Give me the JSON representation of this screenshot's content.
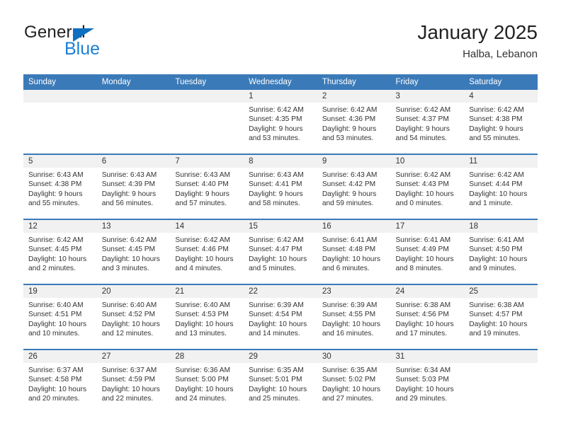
{
  "brand": {
    "name_part1": "General",
    "name_part2": "Blue",
    "triangle_color": "#0f6fc0",
    "blue_text_color": "#1b7fd4"
  },
  "header": {
    "title": "January 2025",
    "subtitle": "Halba, Lebanon",
    "accent_color": "#3b7ab8",
    "band_color": "#f1f1f1"
  },
  "weekday_headers": [
    "Sunday",
    "Monday",
    "Tuesday",
    "Wednesday",
    "Thursday",
    "Friday",
    "Saturday"
  ],
  "weeks": [
    [
      {
        "day": "",
        "lines": []
      },
      {
        "day": "",
        "lines": []
      },
      {
        "day": "",
        "lines": []
      },
      {
        "day": "1",
        "lines": [
          "Sunrise: 6:42 AM",
          "Sunset: 4:35 PM",
          "Daylight: 9 hours",
          "and 53 minutes."
        ]
      },
      {
        "day": "2",
        "lines": [
          "Sunrise: 6:42 AM",
          "Sunset: 4:36 PM",
          "Daylight: 9 hours",
          "and 53 minutes."
        ]
      },
      {
        "day": "3",
        "lines": [
          "Sunrise: 6:42 AM",
          "Sunset: 4:37 PM",
          "Daylight: 9 hours",
          "and 54 minutes."
        ]
      },
      {
        "day": "4",
        "lines": [
          "Sunrise: 6:42 AM",
          "Sunset: 4:38 PM",
          "Daylight: 9 hours",
          "and 55 minutes."
        ]
      }
    ],
    [
      {
        "day": "5",
        "lines": [
          "Sunrise: 6:43 AM",
          "Sunset: 4:38 PM",
          "Daylight: 9 hours",
          "and 55 minutes."
        ]
      },
      {
        "day": "6",
        "lines": [
          "Sunrise: 6:43 AM",
          "Sunset: 4:39 PM",
          "Daylight: 9 hours",
          "and 56 minutes."
        ]
      },
      {
        "day": "7",
        "lines": [
          "Sunrise: 6:43 AM",
          "Sunset: 4:40 PM",
          "Daylight: 9 hours",
          "and 57 minutes."
        ]
      },
      {
        "day": "8",
        "lines": [
          "Sunrise: 6:43 AM",
          "Sunset: 4:41 PM",
          "Daylight: 9 hours",
          "and 58 minutes."
        ]
      },
      {
        "day": "9",
        "lines": [
          "Sunrise: 6:43 AM",
          "Sunset: 4:42 PM",
          "Daylight: 9 hours",
          "and 59 minutes."
        ]
      },
      {
        "day": "10",
        "lines": [
          "Sunrise: 6:42 AM",
          "Sunset: 4:43 PM",
          "Daylight: 10 hours",
          "and 0 minutes."
        ]
      },
      {
        "day": "11",
        "lines": [
          "Sunrise: 6:42 AM",
          "Sunset: 4:44 PM",
          "Daylight: 10 hours",
          "and 1 minute."
        ]
      }
    ],
    [
      {
        "day": "12",
        "lines": [
          "Sunrise: 6:42 AM",
          "Sunset: 4:45 PM",
          "Daylight: 10 hours",
          "and 2 minutes."
        ]
      },
      {
        "day": "13",
        "lines": [
          "Sunrise: 6:42 AM",
          "Sunset: 4:45 PM",
          "Daylight: 10 hours",
          "and 3 minutes."
        ]
      },
      {
        "day": "14",
        "lines": [
          "Sunrise: 6:42 AM",
          "Sunset: 4:46 PM",
          "Daylight: 10 hours",
          "and 4 minutes."
        ]
      },
      {
        "day": "15",
        "lines": [
          "Sunrise: 6:42 AM",
          "Sunset: 4:47 PM",
          "Daylight: 10 hours",
          "and 5 minutes."
        ]
      },
      {
        "day": "16",
        "lines": [
          "Sunrise: 6:41 AM",
          "Sunset: 4:48 PM",
          "Daylight: 10 hours",
          "and 6 minutes."
        ]
      },
      {
        "day": "17",
        "lines": [
          "Sunrise: 6:41 AM",
          "Sunset: 4:49 PM",
          "Daylight: 10 hours",
          "and 8 minutes."
        ]
      },
      {
        "day": "18",
        "lines": [
          "Sunrise: 6:41 AM",
          "Sunset: 4:50 PM",
          "Daylight: 10 hours",
          "and 9 minutes."
        ]
      }
    ],
    [
      {
        "day": "19",
        "lines": [
          "Sunrise: 6:40 AM",
          "Sunset: 4:51 PM",
          "Daylight: 10 hours",
          "and 10 minutes."
        ]
      },
      {
        "day": "20",
        "lines": [
          "Sunrise: 6:40 AM",
          "Sunset: 4:52 PM",
          "Daylight: 10 hours",
          "and 12 minutes."
        ]
      },
      {
        "day": "21",
        "lines": [
          "Sunrise: 6:40 AM",
          "Sunset: 4:53 PM",
          "Daylight: 10 hours",
          "and 13 minutes."
        ]
      },
      {
        "day": "22",
        "lines": [
          "Sunrise: 6:39 AM",
          "Sunset: 4:54 PM",
          "Daylight: 10 hours",
          "and 14 minutes."
        ]
      },
      {
        "day": "23",
        "lines": [
          "Sunrise: 6:39 AM",
          "Sunset: 4:55 PM",
          "Daylight: 10 hours",
          "and 16 minutes."
        ]
      },
      {
        "day": "24",
        "lines": [
          "Sunrise: 6:38 AM",
          "Sunset: 4:56 PM",
          "Daylight: 10 hours",
          "and 17 minutes."
        ]
      },
      {
        "day": "25",
        "lines": [
          "Sunrise: 6:38 AM",
          "Sunset: 4:57 PM",
          "Daylight: 10 hours",
          "and 19 minutes."
        ]
      }
    ],
    [
      {
        "day": "26",
        "lines": [
          "Sunrise: 6:37 AM",
          "Sunset: 4:58 PM",
          "Daylight: 10 hours",
          "and 20 minutes."
        ]
      },
      {
        "day": "27",
        "lines": [
          "Sunrise: 6:37 AM",
          "Sunset: 4:59 PM",
          "Daylight: 10 hours",
          "and 22 minutes."
        ]
      },
      {
        "day": "28",
        "lines": [
          "Sunrise: 6:36 AM",
          "Sunset: 5:00 PM",
          "Daylight: 10 hours",
          "and 24 minutes."
        ]
      },
      {
        "day": "29",
        "lines": [
          "Sunrise: 6:35 AM",
          "Sunset: 5:01 PM",
          "Daylight: 10 hours",
          "and 25 minutes."
        ]
      },
      {
        "day": "30",
        "lines": [
          "Sunrise: 6:35 AM",
          "Sunset: 5:02 PM",
          "Daylight: 10 hours",
          "and 27 minutes."
        ]
      },
      {
        "day": "31",
        "lines": [
          "Sunrise: 6:34 AM",
          "Sunset: 5:03 PM",
          "Daylight: 10 hours",
          "and 29 minutes."
        ]
      },
      {
        "day": "",
        "lines": []
      }
    ]
  ]
}
